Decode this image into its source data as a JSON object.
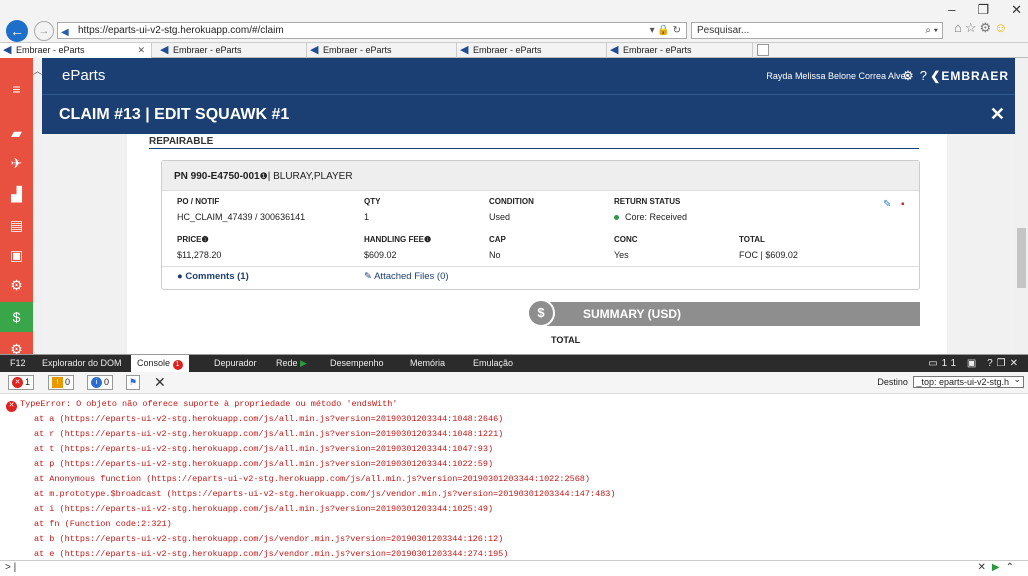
{
  "browser": {
    "url": "https://eparts-ui-v2-stg.herokuapp.com/#/claim",
    "search_placeholder": "Pesquisar...",
    "tabs": [
      {
        "label": "Embraer - eParts"
      },
      {
        "label": "Embraer - eParts"
      },
      {
        "label": "Embraer - eParts"
      },
      {
        "label": "Embraer - eParts"
      },
      {
        "label": "Embraer - eParts"
      }
    ]
  },
  "app": {
    "logo": "eParts",
    "user": "Rayda Melissa Belone Correa Alves",
    "brand": "EMBRAER",
    "claim_title": "CLAIM #13 | EDIT SQUAWK #1"
  },
  "repairable": {
    "heading": "REPAIRABLE",
    "part_number": "PN 990-E4750-001",
    "part_desc": "BLURAY,PLAYER",
    "fields": {
      "po_label": "PO / NOTIF",
      "po_value": "HC_CLAIM_47439 / 300636141",
      "qty_label": "QTY",
      "qty_value": "1",
      "cond_label": "CONDITION",
      "cond_value": "Used",
      "ret_label": "RETURN STATUS",
      "ret_value": "Core: Received",
      "price_label": "PRICE",
      "price_value": "$11,278.20",
      "hfee_label": "HANDLING FEE",
      "hfee_value": "$609.02",
      "cap_label": "CAP",
      "cap_value": "No",
      "conc_label": "CONC",
      "conc_value": "Yes",
      "total_label": "TOTAL",
      "total_value": "FOC | $609.02"
    },
    "comments": "Comments (1)",
    "attached": "Attached Files (0)"
  },
  "summary": {
    "title": "SUMMARY (USD)",
    "total_label": "TOTAL"
  },
  "devtools": {
    "tabs": [
      "F12",
      "Explorador do DOM",
      "Console",
      "Depurador",
      "Rede",
      "Desempenho",
      "Memória",
      "Emulação"
    ],
    "console_badge": "1",
    "error_count": "1",
    "warn_count": "0",
    "info_count": "0",
    "right_num": "11",
    "dest_label": "Destino",
    "dest_value": "_top: eparts-ui-v2-stg.h",
    "prompt": ">",
    "error_lines": [
      "TypeError: O objeto não oferece suporte à propriedade ou método 'endsWith'",
      "at a (https://eparts-ui-v2-stg.herokuapp.com/js/all.min.js?version=20190301203344:1048:2646)",
      "at r (https://eparts-ui-v2-stg.herokuapp.com/js/all.min.js?version=20190301203344:1048:1221)",
      "at t (https://eparts-ui-v2-stg.herokuapp.com/js/all.min.js?version=20190301203344:1047:93)",
      "at p (https://eparts-ui-v2-stg.herokuapp.com/js/all.min.js?version=20190301203344:1022:59)",
      "at Anonymous function (https://eparts-ui-v2-stg.herokuapp.com/js/all.min.js?version=20190301203344:1022:2568)",
      "at m.prototype.$broadcast (https://eparts-ui-v2-stg.herokuapp.com/js/vendor.min.js?version=20190301203344:147:483)",
      "at i (https://eparts-ui-v2-stg.herokuapp.com/js/all.min.js?version=20190301203344:1025:49)",
      "at fn (Function code:2:321)",
      "at b (https://eparts-ui-v2-stg.herokuapp.com/js/vendor.min.js?version=20190301203344:126:12)",
      "at e (https://eparts-ui-v2-stg.herokuapp.com/js/vendor.min.js?version=20190301203344:274:195)"
    ]
  },
  "colors": {
    "navy": "#1b3f73",
    "sidebar_red": "#e8503f",
    "money_green": "#3aa64a",
    "error_red": "#c41717"
  }
}
